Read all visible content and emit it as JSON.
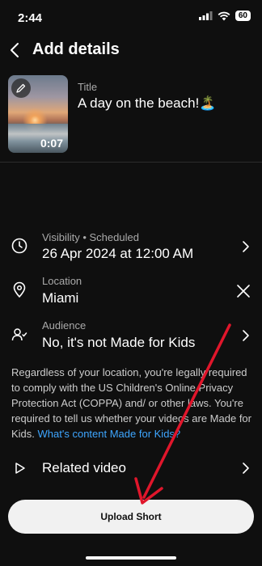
{
  "status": {
    "time": "2:44",
    "battery": "60"
  },
  "header": {
    "title": "Add details"
  },
  "video": {
    "title_label": "Title",
    "title_value": "A day on the beach!🏝️",
    "duration": "0:07"
  },
  "visibility": {
    "label": "Visibility • Scheduled",
    "value": "26 Apr 2024 at 12:00 AM"
  },
  "location": {
    "label": "Location",
    "value": "Miami"
  },
  "audience": {
    "label": "Audience",
    "value": "No, it's not Made for Kids"
  },
  "notice": {
    "text": "Regardless of your location, you're legally required to comply with the US Children's Online Privacy Protection Act (COPPA) and/ or other laws. You're required to tell us whether your videos are Made for Kids.",
    "link": "What's content Made for Kids?"
  },
  "related": {
    "label": "Related video"
  },
  "upload_button": {
    "label": "Upload Short"
  },
  "colors": {
    "accent_link": "#3ea6ff",
    "annotation_arrow": "#e0162b",
    "background": "#0f0f0f"
  }
}
